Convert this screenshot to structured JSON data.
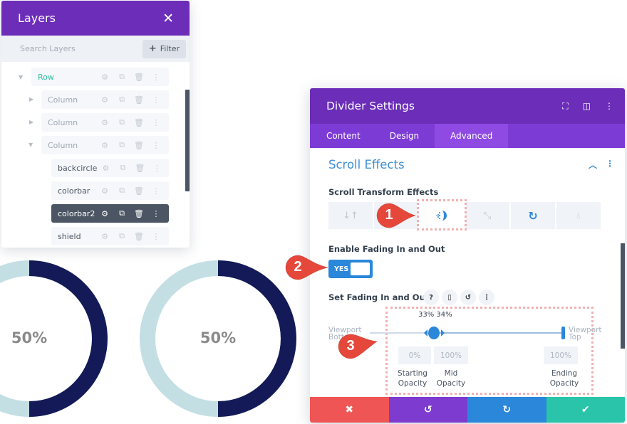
{
  "donuts": [
    {
      "label": "50%",
      "value_percent": 50,
      "track_color": "#c4dfe4",
      "fill_color": "#141a57"
    },
    {
      "label": "50%",
      "value_percent": 50,
      "track_color": "#c4dfe4",
      "fill_color": "#141a57"
    }
  ],
  "layers": {
    "title": "Layers",
    "close_icon": "close-icon",
    "search_placeholder": "Search Layers",
    "filter_label": "Filter",
    "items": [
      {
        "name": "Row",
        "type": "row",
        "expanded": true
      },
      {
        "name": "Column",
        "type": "column",
        "expanded": false
      },
      {
        "name": "Column",
        "type": "column",
        "expanded": false
      },
      {
        "name": "Column",
        "type": "column",
        "expanded": true
      },
      {
        "name": "backcircle",
        "type": "module",
        "active": false
      },
      {
        "name": "colorbar",
        "type": "module",
        "active": false
      },
      {
        "name": "colorbar2",
        "type": "module",
        "active": true
      },
      {
        "name": "shield",
        "type": "module",
        "active": false
      }
    ],
    "row_actions": [
      "settings-icon",
      "duplicate-icon",
      "delete-icon",
      "more-icon"
    ]
  },
  "modal": {
    "title": "Divider Settings",
    "header_icons": [
      "fullscreen-icon",
      "split-view-icon",
      "more-icon"
    ],
    "tabs": [
      {
        "label": "Content",
        "active": false
      },
      {
        "label": "Design",
        "active": false
      },
      {
        "label": "Advanced",
        "active": true
      }
    ],
    "section_title": "Scroll Effects",
    "scroll_transform_label": "Scroll Transform Effects",
    "effects": [
      {
        "name": "vertical-motion",
        "selected": false
      },
      {
        "name": "horizontal-motion",
        "selected": false
      },
      {
        "name": "fading",
        "selected": true
      },
      {
        "name": "scaling",
        "selected": false
      },
      {
        "name": "rotating",
        "selected": false
      },
      {
        "name": "blur",
        "selected": false
      }
    ],
    "enable_fading_label": "Enable Fading In and Out",
    "toggle_value": "YES",
    "set_fading_label": "Set Fading In and Out",
    "slider": {
      "start_label": "Viewport Bottom",
      "end_label": "Viewport Top",
      "pct_readout": "33% 34%",
      "mid_start_percent": 33,
      "mid_end_percent": 34,
      "end_percent": 100
    },
    "opacities": {
      "starting": {
        "value": "0%",
        "label_1": "Starting",
        "label_2": "Opacity"
      },
      "mid": {
        "value": "100%",
        "label_1": "Mid",
        "label_2": "Opacity"
      },
      "ending": {
        "value": "100%",
        "label_1": "Ending",
        "label_2": "Opacity"
      }
    },
    "footer": {
      "cancel_color": "#ef5555",
      "undo_color": "#7d3bcf",
      "redo_color": "#2b87da",
      "save_color": "#29c4a9"
    }
  },
  "callouts": [
    {
      "number": "1",
      "target": "fading-effect"
    },
    {
      "number": "2",
      "target": "fading-toggle"
    },
    {
      "number": "3",
      "target": "fading-slider"
    }
  ],
  "colors": {
    "purple": "#6c2eb9",
    "tab_bar": "#7d3bd6",
    "accent_blue": "#2b87da",
    "callout_red": "#e5483b"
  }
}
